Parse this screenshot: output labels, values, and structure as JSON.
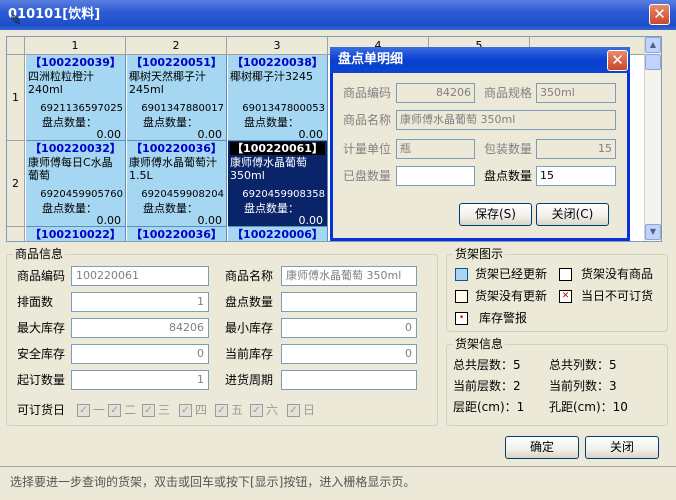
{
  "window": {
    "title": "010101[饮料]"
  },
  "grid": {
    "columns": [
      "1",
      "2",
      "3",
      "4",
      "5"
    ],
    "rows": [
      "1",
      "2"
    ],
    "cells": [
      {
        "code": "【100220039】",
        "name": "四洲粒粒橙汁240ml",
        "barcode": "6921136597025",
        "count_label": "盘点数量：",
        "count": "0.00"
      },
      {
        "code": "【100220051】",
        "name": "椰树天然椰子汁245ml",
        "barcode": "6901347880017",
        "count_label": "盘点数量：",
        "count": "0.00"
      },
      {
        "code": "【100220038】",
        "name": "椰树椰子汁3245",
        "barcode": "6901347800053",
        "count_label": "盘点数量：",
        "count": "0.00"
      },
      {
        "code": "【100220032】",
        "name": "康师傅每日C水晶葡萄",
        "barcode": "6920459905760",
        "count_label": "盘点数量：",
        "count": "0.00"
      },
      {
        "code": "【100220036】",
        "name": "康师傅水晶葡萄汁1.5L",
        "barcode": "6920459908204",
        "count_label": "盘点数量：",
        "count": "0.00"
      },
      {
        "code": "【100220061】",
        "name": "康师傅水晶葡萄 350ml",
        "barcode": "6920459908358",
        "count_label": "盘点数量：",
        "count": "0.00"
      },
      {
        "code": "【100210022】"
      },
      {
        "code": "【100220036】"
      },
      {
        "code": "【100220006】"
      }
    ]
  },
  "dialog": {
    "title": "盘点单明细",
    "code_label": "商品编码",
    "code_value": "84206",
    "spec_label": "商品规格",
    "spec_value": "350ml",
    "name_label": "商品名称",
    "name_value": "康师傅水晶葡萄 350ml",
    "unit_label": "计量单位",
    "unit_value": "瓶",
    "pack_label": "包装数量",
    "pack_value": "15",
    "checked_label": "已盘数量",
    "checked_value": "",
    "count_label": "盘点数量",
    "count_value": "15",
    "save_label": "保存(S)",
    "close_label": "关闭(C)"
  },
  "product_info": {
    "title": "商品信息",
    "code_label": "商品编码",
    "code_value": "100220061",
    "name_label": "商品名称",
    "name_value": "康师傅水晶葡萄 350ml",
    "faces_label": "排面数",
    "faces_value": "1",
    "count_label": "盘点数量",
    "count_value": "",
    "max_label": "最大库存",
    "max_value": "84206",
    "min_label": "最小库存",
    "min_value": "0",
    "safe_label": "安全库存",
    "safe_value": "0",
    "current_label": "当前库存",
    "current_value": "0",
    "moq_label": "起订数量",
    "moq_value": "1",
    "cycle_label": "进货周期",
    "cycle_value": "",
    "days_label": "可订货日",
    "days": [
      "一",
      "二",
      "三",
      "四",
      "五",
      "六",
      "日"
    ]
  },
  "legend": {
    "title": "货架图示",
    "updated": "货架已经更新",
    "no_goods": "货架没有商品",
    "not_updated": "货架没有更新",
    "unorderable": "当日不可订货",
    "alarm": "库存警报",
    "color_updated": "#a6d7f2",
    "color_alarm": "#d40000"
  },
  "shelf_info": {
    "title": "货架信息",
    "total_layers": "总共层数：5",
    "total_cols": "总共列数：5",
    "cur_layer": "当前层数：2",
    "cur_col": "当前列数：3",
    "layer_dist": "层距(cm)：1",
    "hole_dist": "孔距(cm)：10"
  },
  "footer": {
    "ok_label": "确定",
    "close_label": "关闭",
    "status": "选择要进一步查询的货架，双击或回车或按下[显示]按钮，进入栅格显示页。"
  }
}
